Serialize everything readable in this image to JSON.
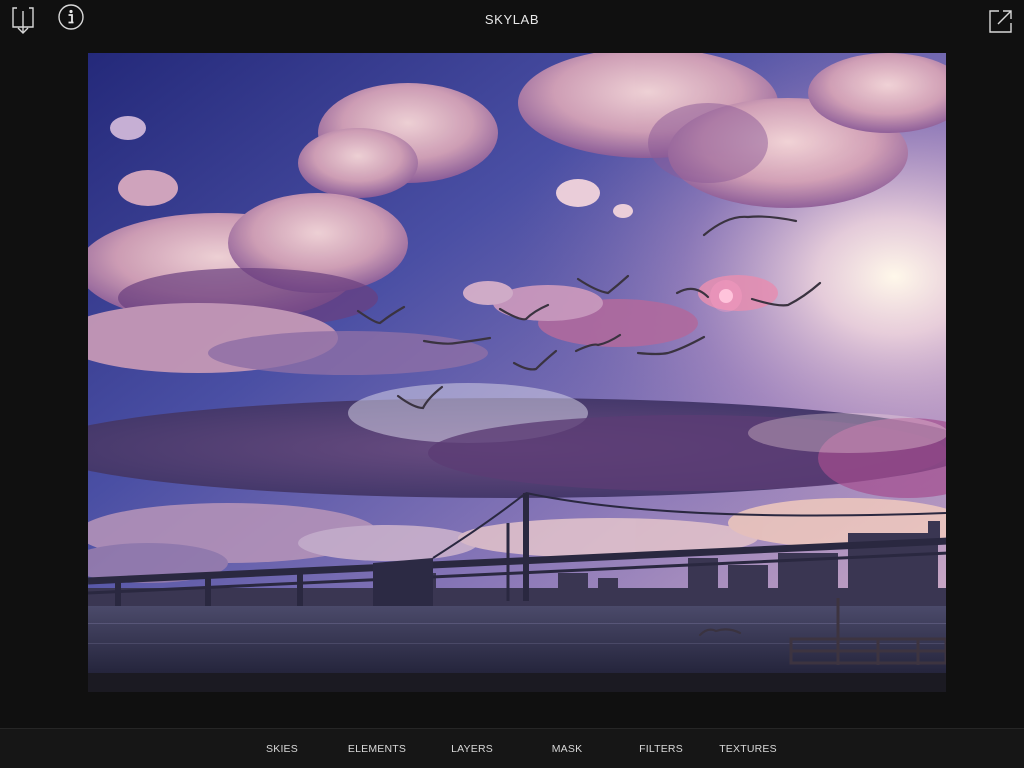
{
  "app": {
    "title": "SKYLAB"
  },
  "header": {
    "left_icons": [
      "download-icon",
      "info-icon"
    ],
    "right_icons": [
      "share-icon"
    ]
  },
  "canvas": {
    "image": "edited photo: purple sunset sky with pink clouds, flock of birds, suspension bridge over water, city skyline, pier railing"
  },
  "toolbar": {
    "tabs": [
      {
        "label": "SKIES"
      },
      {
        "label": "ELEMENTS"
      },
      {
        "label": "LAYERS"
      },
      {
        "label": "MASK"
      },
      {
        "label": "FILTERS"
      },
      {
        "label": "TEXTURES"
      }
    ]
  },
  "colors": {
    "background": "#101010",
    "toolbar": "#161616",
    "text": "#e6e6e6"
  }
}
